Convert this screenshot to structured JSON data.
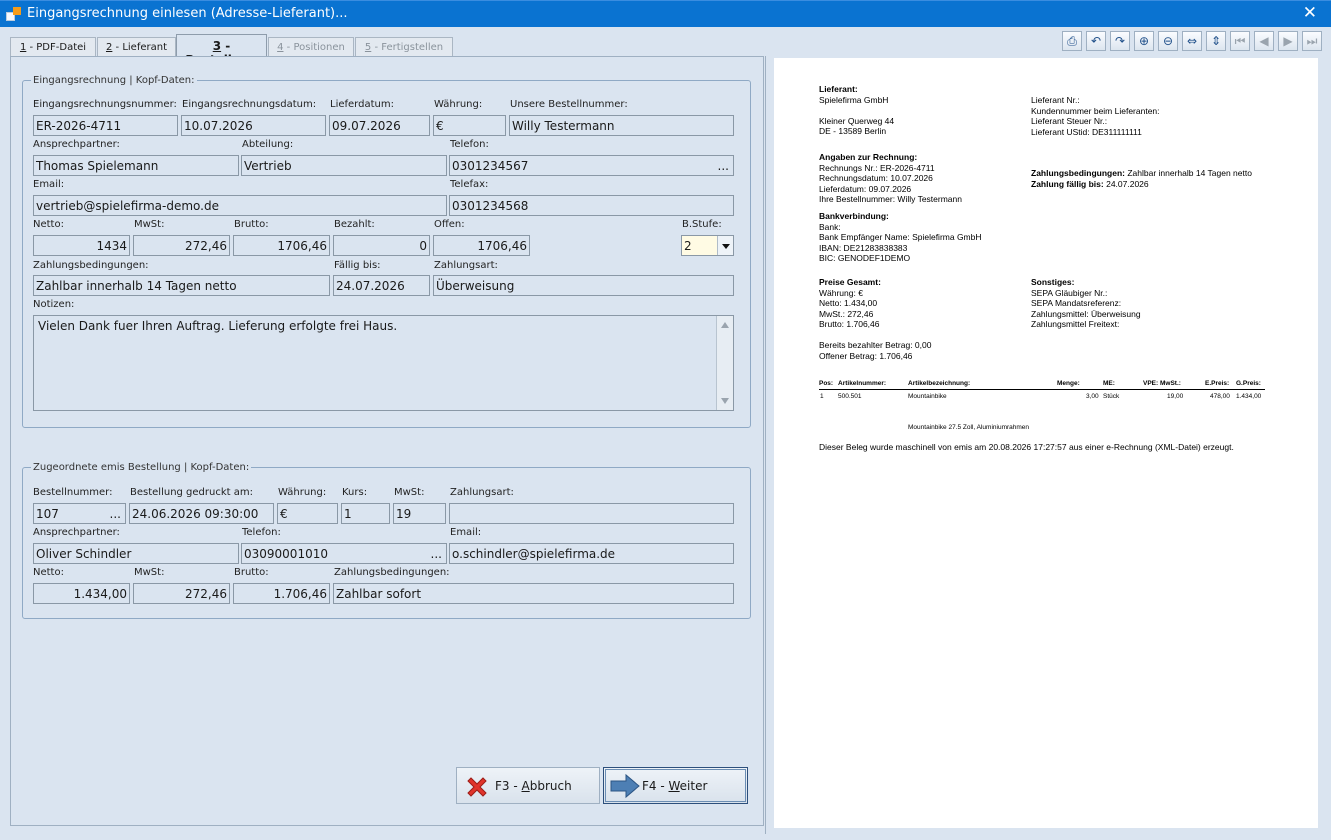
{
  "window": {
    "title": "Eingangsrechnung einlesen (Adresse-Lieferant)...",
    "close_glyph": "✕"
  },
  "tabs": [
    {
      "num": "1",
      "label": " - PDF-Datei"
    },
    {
      "num": "2",
      "label": " - Lieferant"
    },
    {
      "num": "3",
      "label": " - Bestellung"
    },
    {
      "num": "4",
      "label": " - Positionen"
    },
    {
      "num": "5",
      "label": " - Fertigstellen"
    }
  ],
  "invoice": {
    "legend": "Eingangsrechnung | Kopf-Daten:",
    "labels": {
      "number": "Eingangsrechnungsnummer:",
      "date": "Eingangsrechnungsdatum:",
      "delivery_date": "Lieferdatum:",
      "currency": "Währung:",
      "order_no": "Unsere Bestellnummer:",
      "contact": "Ansprechpartner:",
      "department": "Abteilung:",
      "phone": "Telefon:",
      "email": "Email:",
      "fax": "Telefax:",
      "net": "Netto:",
      "vat": "MwSt:",
      "gross": "Brutto:",
      "paid": "Bezahlt:",
      "open": "Offen:",
      "level": "B.Stufe:",
      "terms": "Zahlungsbedingungen:",
      "due": "Fällig bis:",
      "payment_type": "Zahlungsart:",
      "notes": "Notizen:"
    },
    "values": {
      "number": "ER-2026-4711",
      "date": "10.07.2026",
      "delivery_date": "09.07.2026",
      "currency": "€",
      "order_no": "Willy Testermann",
      "contact": "Thomas Spielemann",
      "department": "Vertrieb",
      "phone": "0301234567",
      "email": "vertrieb@spielefirma-demo.de",
      "fax": "0301234568",
      "net": "1434",
      "vat": "272,46",
      "gross": "1706,46",
      "paid": "0",
      "open": "1706,46",
      "level": "2",
      "terms": "Zahlbar innerhalb 14 Tagen netto",
      "due": "24.07.2026",
      "payment_type": "Überweisung",
      "notes": "Vielen Dank fuer Ihren Auftrag. Lieferung erfolgte frei Haus."
    }
  },
  "order": {
    "legend": "Zugeordnete emis Bestellung | Kopf-Daten:",
    "labels": {
      "number": "Bestellnummer:",
      "printed": "Bestellung gedruckt am:",
      "currency": "Währung:",
      "rate": "Kurs:",
      "vat_rate": "MwSt:",
      "payment_type": "Zahlungsart:",
      "contact": "Ansprechpartner:",
      "phone": "Telefon:",
      "email": "Email:",
      "net": "Netto:",
      "vat": "MwSt:",
      "gross": "Brutto:",
      "terms": "Zahlungsbedingungen:"
    },
    "values": {
      "number": "107",
      "printed": "24.06.2026 09:30:00",
      "currency": "€",
      "rate": "1",
      "vat_rate": "19",
      "payment_type": "",
      "contact": "Oliver Schindler",
      "phone": "03090001010",
      "email": "o.schindler@spielefirma.de",
      "net": "1.434,00",
      "vat": "272,46",
      "gross": "1.706,46",
      "terms": "Zahlbar sofort"
    }
  },
  "ellipsis": "...",
  "buttons": {
    "cancel_key": "F3 - ",
    "cancel_accel": "A",
    "cancel_rest": "bbruch",
    "next_key": "F4 - ",
    "next_accel": "W",
    "next_rest": "eiter"
  },
  "doc": {
    "l_title": "Lieferant:",
    "l_name": "Spielefirma GmbH",
    "l_street": "Kleiner Querweg 44",
    "l_city": "DE - 13589 Berlin",
    "r_lines": [
      "Lieferant Nr.:",
      "Kundennummer beim Lieferanten:",
      "Lieferant Steuer Nr.:",
      "Lieferant UStid: DE311111111"
    ],
    "inv_title": "Angaben zur Rechnung:",
    "inv_lines": [
      "Rechnungs Nr.: ER-2026-4711",
      "Rechnungsdatum: 10.07.2026",
      "Lieferdatum: 09.07.2026",
      "Ihre Bestellnummer: Willy Testermann"
    ],
    "terms_label": "Zahlungsbedingungen:",
    "terms_value": " Zahlbar innerhalb 14 Tagen netto",
    "due_label": "Zahlung fällig bis:",
    "due_value": " 24.07.2026",
    "bank_title": "Bankverbindung:",
    "bank_lines": [
      "Bank:",
      "Bank Empfänger Name: Spielefirma GmbH",
      "IBAN: DE21283838383",
      "BIC: GENODEF1DEMO"
    ],
    "price_title": "Preise Gesamt:",
    "price_lines": [
      "Währung: €",
      "Netto: 1.434,00",
      "MwSt.: 272,46",
      "Brutto: 1.706,46"
    ],
    "misc_title": "Sonstiges:",
    "misc_lines": [
      "SEPA Gläubiger Nr.:",
      "SEPA Mandatsreferenz:",
      "Zahlungsmittel: Überweisung",
      "Zahlungsmittel Freitext:"
    ],
    "paid_lines": [
      "Bereits bezahlter Betrag: 0,00",
      "Offener Betrag: 1.706,46"
    ],
    "table_head": {
      "pos": "Pos:",
      "art": "Artikelnummer:",
      "desc": "Artikelbezeichnung:",
      "qty": "Menge:",
      "unit": "ME:",
      "vpe": "VPE: MwSt.:",
      "price": "E.Preis:",
      "total": "G.Preis:"
    },
    "row": {
      "pos": "1",
      "art": "500.501",
      "desc": "Mountainbike",
      "qty": "3,00",
      "unit": "Stück",
      "vat": "19,00",
      "price": "478,00",
      "total": "1.434,00"
    },
    "row_note": "Mountainbike 27.5 Zoll, Aluminiumrahmen",
    "footer": "Dieser Beleg wurde maschinell von emis am 20.08.2026  17:27:57 aus einer e-Rechnung (XML-Datei) erzeugt."
  },
  "toolbar_icons": [
    "printer-icon",
    "undo-icon",
    "redo-icon",
    "zoom-in-icon",
    "zoom-out-icon",
    "fit-width-icon",
    "fit-page-icon",
    "first-page-icon",
    "prev-page-icon",
    "next-page-icon",
    "last-page-icon"
  ],
  "toolbar_glyphs": [
    "⎙",
    "↶",
    "↷",
    "⊕",
    "⊖",
    "⇔",
    "⇕",
    "⏮",
    "◀",
    "▶",
    "⏭"
  ]
}
